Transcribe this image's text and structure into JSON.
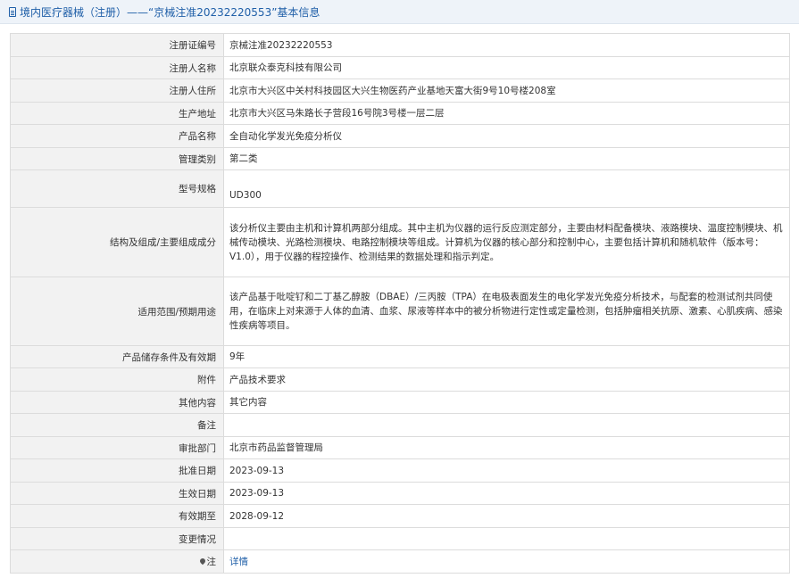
{
  "header": {
    "title": "境内医疗器械（注册）——“京械注准20232220553”基本信息"
  },
  "rows": [
    {
      "label": "注册证编号",
      "value": "京械注准20232220553"
    },
    {
      "label": "注册人名称",
      "value": "北京联众泰克科技有限公司"
    },
    {
      "label": "注册人住所",
      "value": "北京市大兴区中关村科技园区大兴生物医药产业基地天富大街9号10号楼208室"
    },
    {
      "label": "生产地址",
      "value": "北京市大兴区马朱路长子营段16号院3号楼一层二层"
    },
    {
      "label": "产品名称",
      "value": "全自动化学发光免疫分析仪"
    },
    {
      "label": "管理类别",
      "value": "第二类"
    },
    {
      "label": "型号规格",
      "value": "UD300"
    },
    {
      "label": "结构及组成/主要组成成分",
      "value": "该分析仪主要由主机和计算机两部分组成。其中主机为仪器的运行反应测定部分，主要由材料配备模块、液路模块、温度控制模块、机械传动模块、光路检测模块、电路控制模块等组成。计算机为仪器的核心部分和控制中心，主要包括计算机和随机软件（版本号：V1.0），用于仪器的程控操作、检测结果的数据处理和指示判定。"
    },
    {
      "label": "适用范围/预期用途",
      "value": "该产品基于吡啶钌和二丁基乙醇胺（DBAE）/三丙胺（TPA）在电极表面发生的电化学发光免疫分析技术，与配套的检测试剂共同使用，在临床上对来源于人体的血清、血浆、尿液等样本中的被分析物进行定性或定量检测，包括肿瘤相关抗原、激素、心肌疾病、感染性疾病等项目。"
    },
    {
      "label": "产品储存条件及有效期",
      "value": "9年"
    },
    {
      "label": "附件",
      "value": "产品技术要求"
    },
    {
      "label": "其他内容",
      "value": "其它内容"
    },
    {
      "label": "备注",
      "value": ""
    },
    {
      "label": "审批部门",
      "value": "北京市药品监督管理局"
    },
    {
      "label": "批准日期",
      "value": "2023-09-13"
    },
    {
      "label": "生效日期",
      "value": "2023-09-13"
    },
    {
      "label": "有效期至",
      "value": "2028-09-12"
    },
    {
      "label": "变更情况",
      "value": ""
    },
    {
      "label": "注",
      "value": "详情"
    }
  ]
}
